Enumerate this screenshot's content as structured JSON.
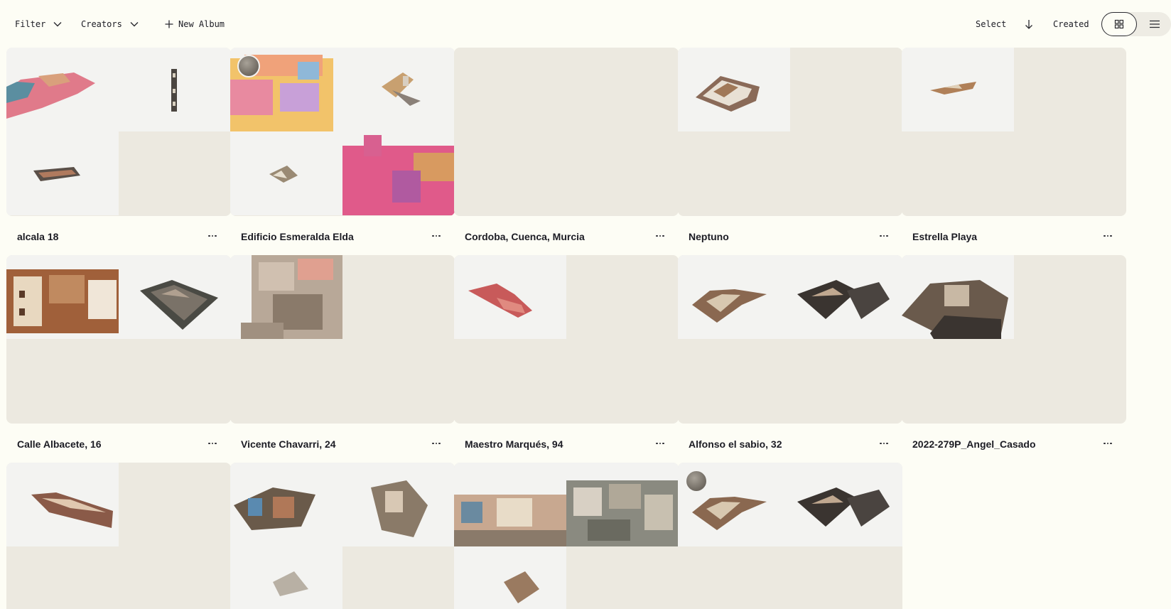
{
  "toolbar": {
    "filter_label": "Filter",
    "creators_label": "Creators",
    "new_album_label": "New Album",
    "select_label": "Select",
    "sort_label": "Created"
  },
  "albums": [
    {
      "title": "alcala 18"
    },
    {
      "title": "Edificio Esmeralda Elda"
    },
    {
      "title": "Cordoba, Cuenca, Murcia"
    },
    {
      "title": "Neptuno"
    },
    {
      "title": "Estrella Playa"
    },
    {
      "title": "Calle Albacete, 16"
    },
    {
      "title": "Vicente Chavarri, 24"
    },
    {
      "title": "Maestro Marqués, 94"
    },
    {
      "title": "Alfonso el sabio, 32"
    },
    {
      "title": "2022-279P_Angel_Casado"
    },
    {
      "title": ""
    },
    {
      "title": ""
    },
    {
      "title": ""
    },
    {
      "title": ""
    }
  ],
  "colors": {
    "background": "#fdfdf5",
    "thumb_empty": "#ece9e0",
    "thumb_filled": "#f3f3f1",
    "text": "#1c1c24"
  },
  "icons": {
    "filter_chevron": "chevron-down-icon",
    "creators_chevron": "chevron-down-icon",
    "new_album": "plus-icon",
    "sort_direction": "arrow-down-icon",
    "grid_view": "grid-icon",
    "list_view": "list-icon",
    "card_menu": "more-horizontal-icon"
  }
}
